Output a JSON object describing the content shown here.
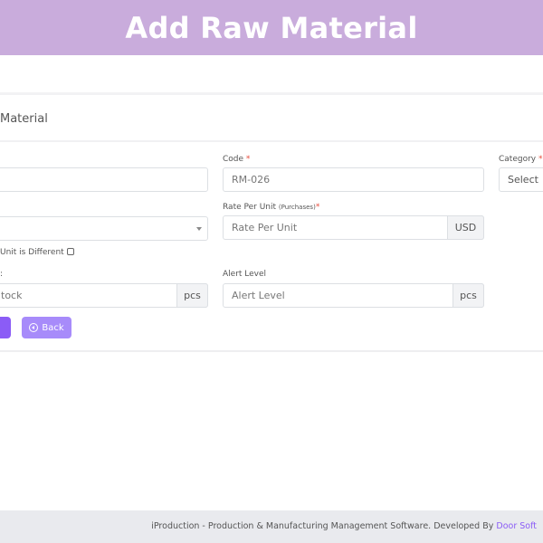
{
  "banner": {
    "title": "Add Raw Material"
  },
  "card": {
    "title": "Material"
  },
  "form": {
    "name_field": {
      "value": ""
    },
    "code": {
      "label": "Code",
      "required_mark": "*",
      "value": "RM-026"
    },
    "category": {
      "label": "Category",
      "required_mark": "*",
      "selected": "Select"
    },
    "unit_select": {
      "selected": ""
    },
    "rate_per_unit": {
      "label": "Rate Per Unit",
      "label_small": "(Purchases)",
      "required_mark": "*",
      "placeholder": "Rate Per Unit",
      "addon": "USD"
    },
    "unit_different": {
      "label": "Unit is Different",
      "checked": false
    },
    "stock": {
      "label": ":",
      "placeholder": "tock",
      "addon": "pcs"
    },
    "alert_level": {
      "label": "Alert Level",
      "placeholder": "Alert Level",
      "addon": "pcs"
    }
  },
  "buttons": {
    "submit_label": "",
    "back_label": "Back"
  },
  "footer": {
    "text": "iProduction - Production & Manufacturing Management Software. Developed By ",
    "link": "Door Soft"
  },
  "colors": {
    "banner": "#c9acdc",
    "accent": "#8b5cf6",
    "accent_light": "#a78bfa",
    "required": "#e74c3c"
  }
}
